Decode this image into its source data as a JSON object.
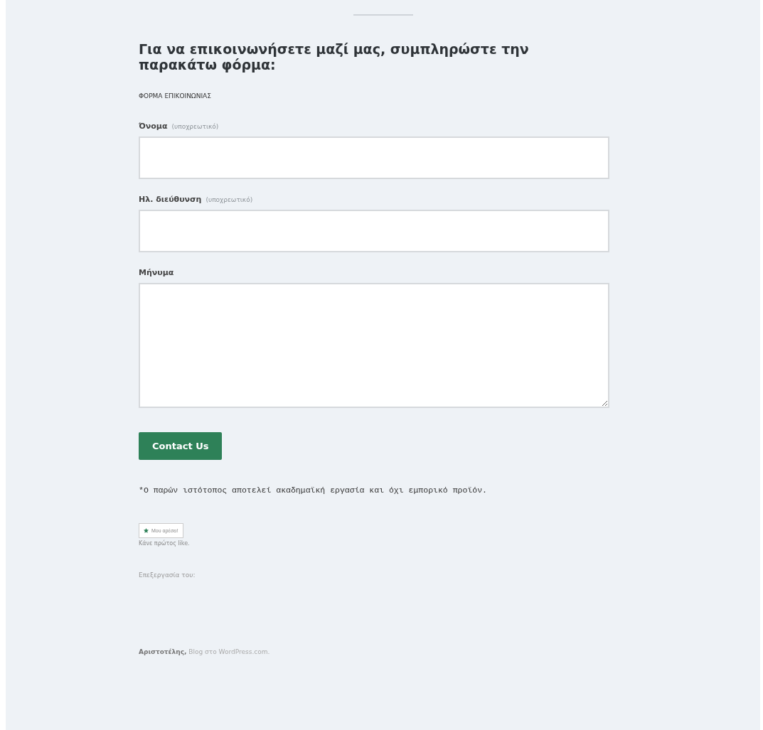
{
  "heading": "Για να επικοινωνήσετε μαζί μας, συμπληρώστε την παρακάτω φόρμα:",
  "form_title": "ΦΟΡΜΑ ΕΠΙΚΟΙΝΩΝΙΑΣ",
  "fields": [
    {
      "kind": "input",
      "label": "Όνομα",
      "note": "(υποχρεωτικό)"
    },
    {
      "kind": "input",
      "label": "Ηλ. διεύθυνση",
      "note": "(υποχρεωτικό)"
    },
    {
      "kind": "textarea",
      "label": "Μήνυμα"
    }
  ],
  "submit": "Contact Us",
  "disclaimer": "*Ο παρών ιστότοπος αποτελεί ακαδημαϊκή εργασία και όχι εμπορικό προϊόν.",
  "like": {
    "button": "Μου αρέσει!",
    "caption": "Κάνε πρώτος like."
  },
  "edited_by": "Επεξεργασία του:",
  "footer": "**Αριστοτέλης,** Blog στο WordPress.com."
}
